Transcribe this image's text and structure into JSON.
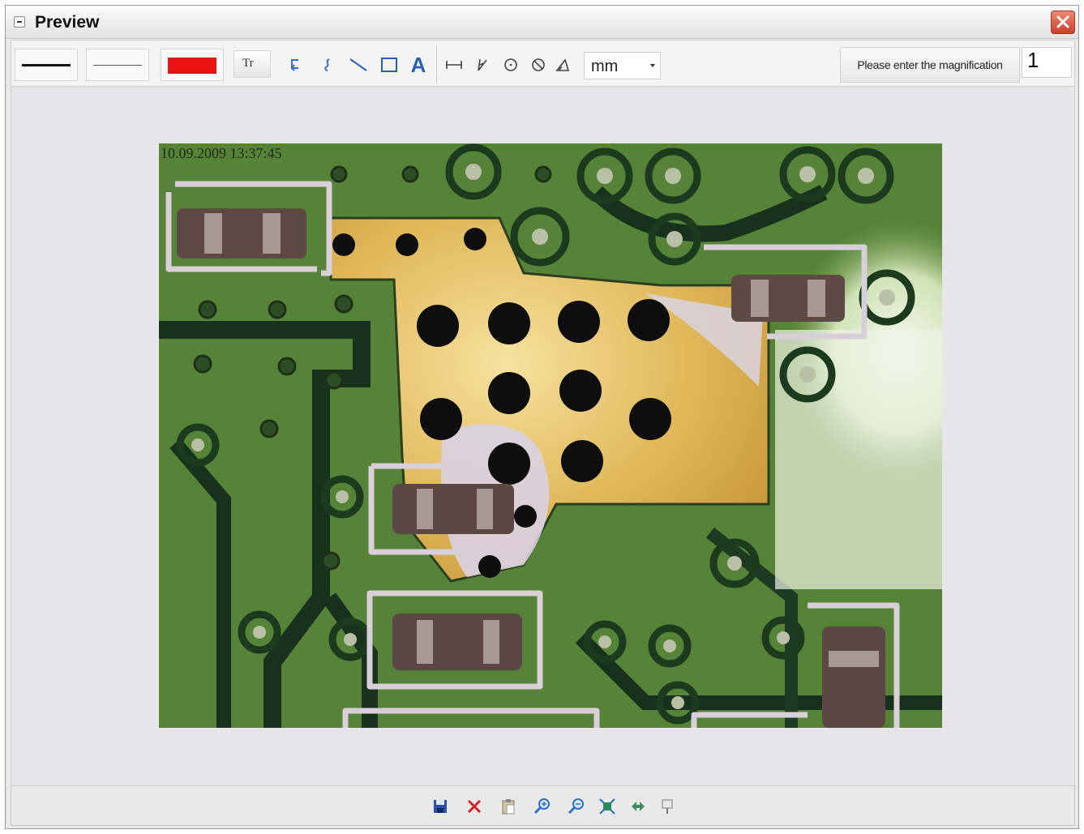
{
  "window": {
    "title": "Preview"
  },
  "toolbar": {
    "line_styles": [
      "thick-line",
      "thin-line"
    ],
    "color": "#e81010",
    "text_tool_label": "Tr",
    "unit": "mm",
    "magnification_label": "Please enter the magnification",
    "magnification_value": "1"
  },
  "preview": {
    "timestamp": "10.09.2009 13:37:45"
  },
  "bottom_toolbar": {
    "icons": [
      "save-icon",
      "delete-icon",
      "paste-icon",
      "zoom-in-icon",
      "zoom-out-icon",
      "fit-window-icon",
      "rotate-icon",
      "pin-icon"
    ]
  }
}
